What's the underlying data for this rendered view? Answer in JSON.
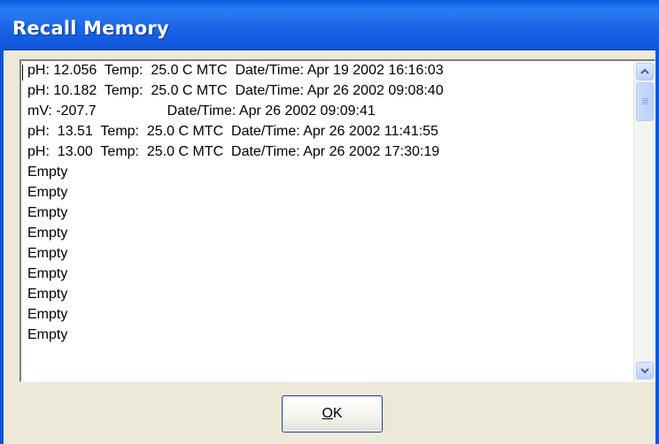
{
  "window": {
    "title": "Recall Memory"
  },
  "memory_list": {
    "entries": [
      "pH: 12.056  Temp:  25.0 C MTC  Date/Time: Apr 19 2002 16:16:03",
      "pH: 10.182  Temp:  25.0 C MTC  Date/Time: Apr 26 2002 09:08:40",
      "mV: -207.7                  Date/Time: Apr 26 2002 09:09:41",
      "pH:  13.51  Temp:  25.0 C MTC  Date/Time: Apr 26 2002 11:41:55",
      "pH:  13.00  Temp:  25.0 C MTC  Date/Time: Apr 26 2002 17:30:19",
      "Empty",
      "Empty",
      "Empty",
      "Empty",
      "Empty",
      "Empty",
      "Empty",
      "Empty",
      "Empty"
    ]
  },
  "buttons": {
    "ok_mnemonic": "O",
    "ok_rest": "K"
  },
  "icons": {
    "scroll_up": "chevron-up-icon",
    "scroll_down": "chevron-down-icon"
  },
  "colors": {
    "titlebar": "#1b66e8",
    "dialog_face": "#ece9d8",
    "button_border": "#1c3f94"
  }
}
